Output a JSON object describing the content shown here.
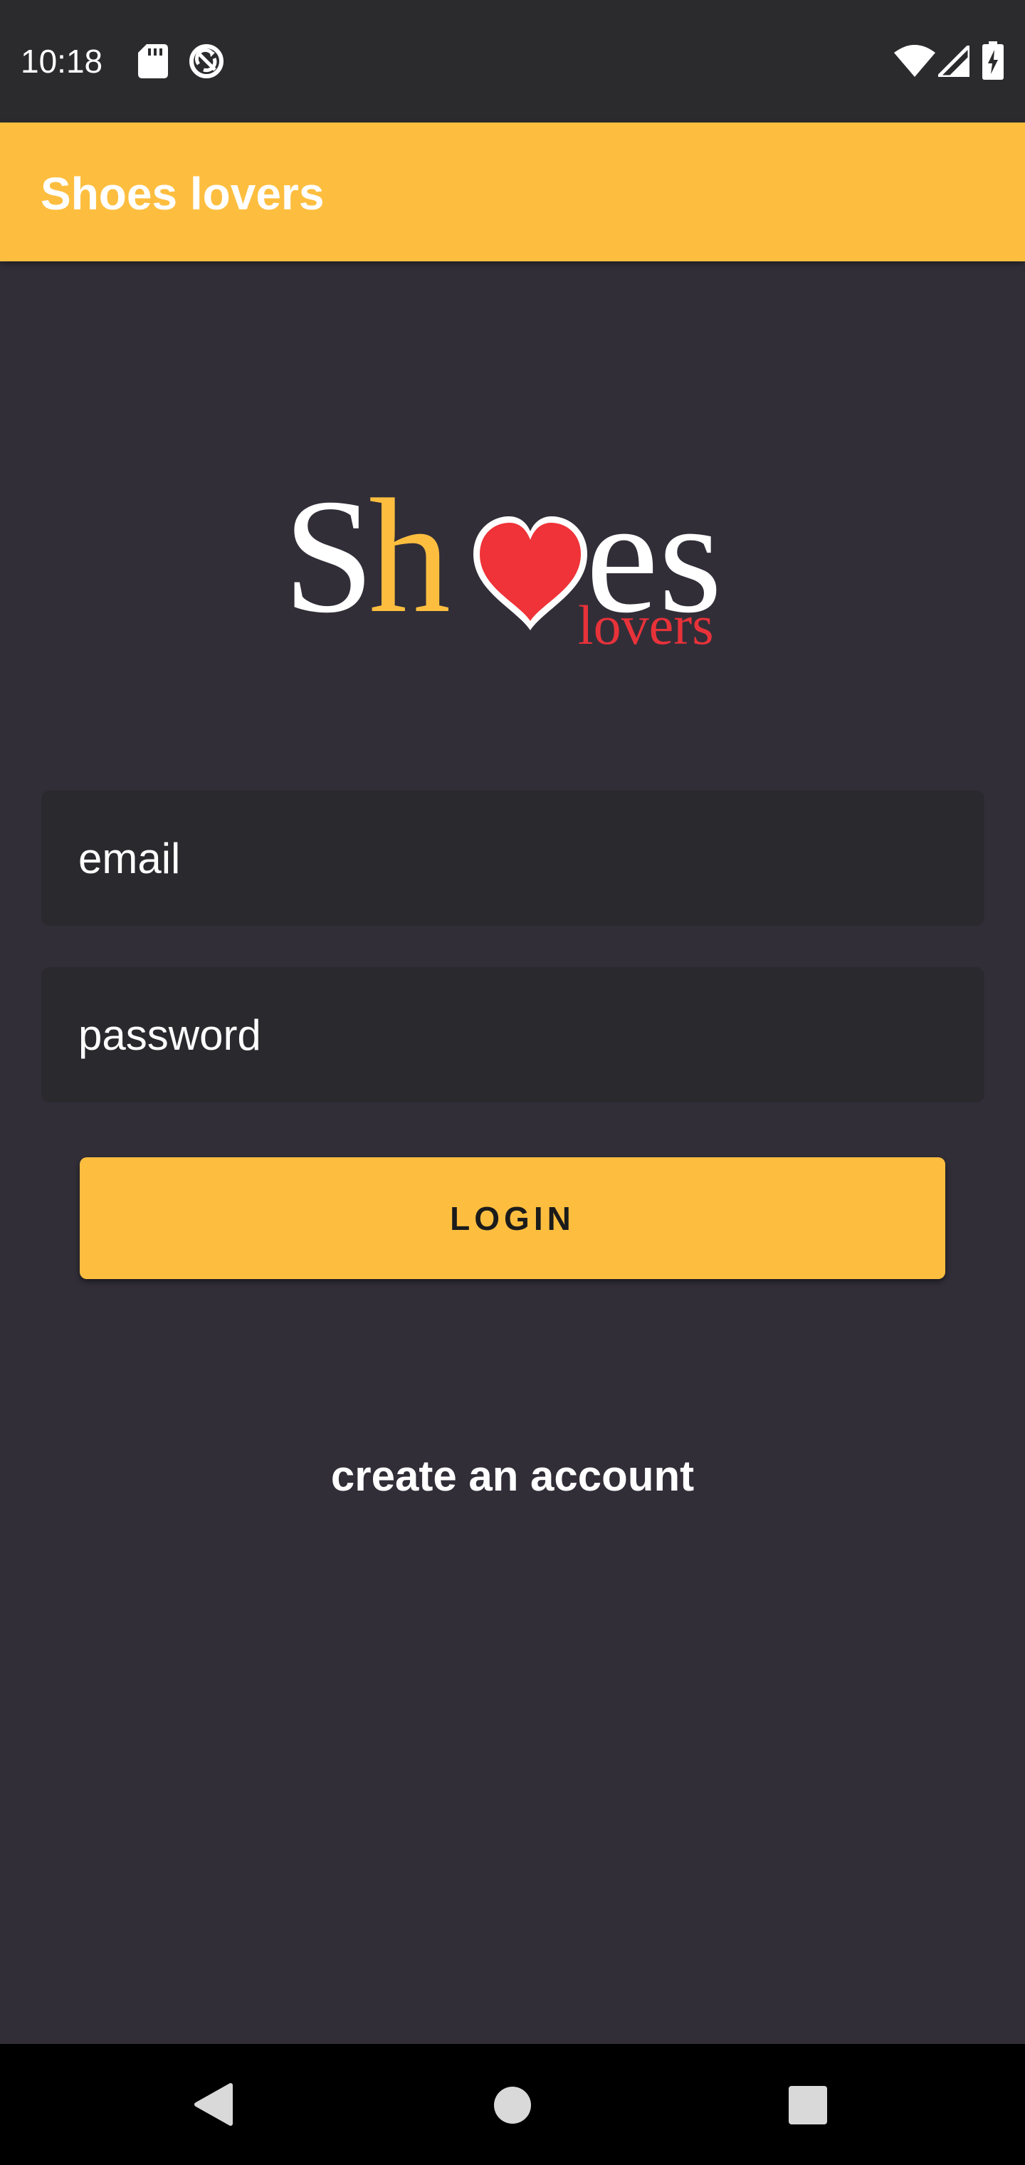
{
  "status_bar": {
    "time": "10:18",
    "icons": [
      "sd-card-icon",
      "sync-icon",
      "wifi-icon",
      "signal-icon",
      "battery-charging-icon"
    ]
  },
  "app_bar": {
    "title": "Shoes lovers",
    "color": "#fdbe3f"
  },
  "logo": {
    "word_s": "S",
    "word_h": "h",
    "word_es": "es",
    "subtitle": "lovers",
    "heart_color": "#ef3338",
    "accent_color": "#fdbe3f"
  },
  "form": {
    "email_placeholder": "email",
    "password_placeholder": "password",
    "login_label": "LOGIN",
    "create_account_label": "create an account"
  },
  "nav_bar": {
    "icons": [
      "back-icon",
      "home-icon",
      "recents-icon"
    ]
  },
  "colors": {
    "background": "#312e38",
    "input_background": "#2a292e",
    "status_bar": "#2b2a2d"
  }
}
